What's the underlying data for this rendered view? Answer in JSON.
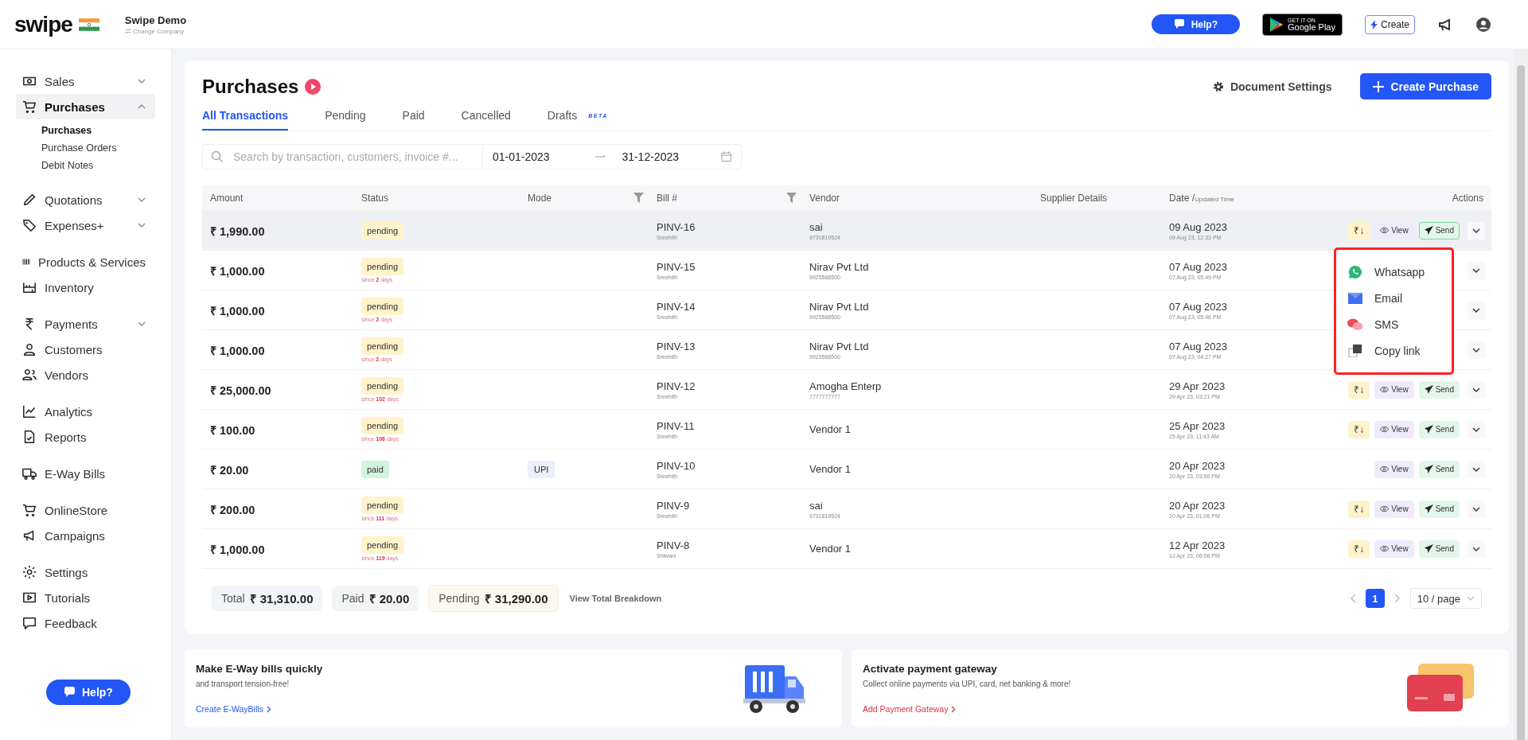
{
  "header": {
    "logo": "swipe",
    "company": "Swipe Demo",
    "change_company": "Change Company",
    "help": "Help?",
    "store_badge": {
      "small": "GET IT ON",
      "large": "Google Play"
    },
    "create": "Create"
  },
  "sidebar": {
    "sections": [
      [
        {
          "label": "Sales",
          "expanded": false,
          "selected": false
        },
        {
          "label": "Purchases",
          "expanded": true,
          "selected": true,
          "children": [
            {
              "label": "Purchases",
              "selected": true
            },
            {
              "label": "Purchase Orders",
              "selected": false
            },
            {
              "label": "Debit Notes",
              "selected": false
            }
          ]
        }
      ],
      [
        {
          "label": "Quotations",
          "expanded": false,
          "selected": false
        },
        {
          "label": "Expenses+",
          "expanded": false,
          "selected": false
        }
      ],
      [
        {
          "label": "Products & Services",
          "selected": false
        },
        {
          "label": "Inventory",
          "selected": false
        }
      ],
      [
        {
          "label": "Payments",
          "expanded": false,
          "selected": false
        },
        {
          "label": "Customers",
          "selected": false
        },
        {
          "label": "Vendors",
          "selected": false
        }
      ],
      [
        {
          "label": "Analytics",
          "selected": false
        },
        {
          "label": "Reports",
          "selected": false
        }
      ],
      [
        {
          "label": "E-Way Bills",
          "selected": false
        }
      ],
      [
        {
          "label": "OnlineStore",
          "selected": false
        },
        {
          "label": "Campaigns",
          "selected": false
        }
      ],
      [
        {
          "label": "Settings",
          "selected": false
        },
        {
          "label": "Tutorials",
          "selected": false
        },
        {
          "label": "Feedback",
          "selected": false
        }
      ]
    ],
    "help": "Help?"
  },
  "page": {
    "title": "Purchases",
    "document_settings": "Document Settings",
    "create_purchase": "Create Purchase",
    "tabs": [
      {
        "label": "All Transactions",
        "selected": true
      },
      {
        "label": "Pending",
        "selected": false
      },
      {
        "label": "Paid",
        "selected": false
      },
      {
        "label": "Cancelled",
        "selected": false
      },
      {
        "label": "Drafts",
        "badge": "BETA",
        "selected": false
      }
    ],
    "search": {
      "placeholder": "Search by transaction, customers, invoice #..."
    },
    "date_from": "01-01-2023",
    "date_to": "31-12-2023"
  },
  "table": {
    "columns": [
      {
        "label": "Amount"
      },
      {
        "label": "Status"
      },
      {
        "label": "Mode",
        "filter": true
      },
      {
        "label": "Bill #",
        "filter": true
      },
      {
        "label": "Vendor"
      },
      {
        "label": "Supplier Details"
      },
      {
        "label": "Date /",
        "sub": "Updated Time"
      },
      {
        "label": "Actions"
      }
    ],
    "rows": [
      {
        "amount": "₹ 1,990.00",
        "status": {
          "label": "pending",
          "kind": "pending"
        },
        "bill": "PINV-16",
        "bill_by": "Sreehith",
        "vendor": "sai",
        "vendor_phone": "9731819524",
        "date": "09 Aug 2023",
        "time": "09 Aug 23, 12:33 PM",
        "highlighted": true,
        "actions": [
          {
            "kind": "pay",
            "label": "₹↓",
            "active": false
          },
          {
            "kind": "view",
            "label": "View",
            "active": false
          },
          {
            "kind": "send",
            "label": "Send",
            "active": true
          }
        ]
      },
      {
        "amount": "₹ 1,000.00",
        "status": {
          "label": "pending",
          "kind": "pending"
        },
        "since": "since **2** days",
        "bill": "PINV-15",
        "bill_by": "Sreehith",
        "vendor": "Nirav Pvt Ltd",
        "vendor_phone": "9925568500",
        "date": "07 Aug 2023",
        "time": "07 Aug 23, 05:49 PM",
        "highlighted": false
      },
      {
        "amount": "₹ 1,000.00",
        "status": {
          "label": "pending",
          "kind": "pending"
        },
        "since": "since **2** days",
        "bill": "PINV-14",
        "bill_by": "Sreehith",
        "vendor": "Nirav Pvt Ltd",
        "vendor_phone": "9925568500",
        "date": "07 Aug 2023",
        "time": "07 Aug 23, 05:46 PM",
        "highlighted": false
      },
      {
        "amount": "₹ 1,000.00",
        "status": {
          "label": "pending",
          "kind": "pending"
        },
        "since": "since **2** days",
        "bill": "PINV-13",
        "bill_by": "Sreehith",
        "vendor": "Nirav Pvt Ltd",
        "vendor_phone": "9925568500",
        "date": "07 Aug 2023",
        "time": "07 Aug 23, 04:27 PM",
        "highlighted": false
      },
      {
        "amount": "₹ 25,000.00",
        "status": {
          "label": "pending",
          "kind": "pending"
        },
        "since": "since **102** days",
        "bill": "PINV-12",
        "bill_by": "Sreehith",
        "vendor": "Amogha Enterp",
        "vendor_phone": "7777777777",
        "date": "29 Apr 2023",
        "time": "29 Apr 23, 03:21 PM",
        "highlighted": false,
        "actions": [
          {
            "kind": "pay",
            "label": "₹↓",
            "active": false
          },
          {
            "kind": "view",
            "label": "View",
            "active": false
          },
          {
            "kind": "send",
            "label": "Send",
            "active": false
          }
        ]
      },
      {
        "amount": "₹ 100.00",
        "status": {
          "label": "pending",
          "kind": "pending"
        },
        "since": "since **106** days",
        "bill": "PINV-11",
        "bill_by": "Sreehith",
        "vendor": "Vendor 1",
        "date": "25 Apr 2023",
        "time": "25 Apr 23, 11:43 AM",
        "highlighted": false,
        "actions": [
          {
            "kind": "pay",
            "label": "₹↓",
            "active": false
          },
          {
            "kind": "view",
            "label": "View",
            "active": false
          },
          {
            "kind": "send",
            "label": "Send",
            "active": false
          }
        ]
      },
      {
        "amount": "₹ 20.00",
        "status": {
          "label": "paid",
          "kind": "paid"
        },
        "mode": "UPI",
        "bill": "PINV-10",
        "bill_by": "Sreehith",
        "vendor": "Vendor 1",
        "date": "20 Apr 2023",
        "time": "20 Apr 23, 03:50 PM",
        "highlighted": false,
        "actions": [
          {
            "kind": "view",
            "label": "View",
            "active": false
          },
          {
            "kind": "send",
            "label": "Send",
            "active": false
          }
        ]
      },
      {
        "amount": "₹ 200.00",
        "status": {
          "label": "pending",
          "kind": "pending"
        },
        "since": "since **111** days",
        "bill": "PINV-9",
        "bill_by": "Sreehith",
        "vendor": "sai",
        "vendor_phone": "9731819524",
        "date": "20 Apr 2023",
        "time": "20 Apr 23, 01:06 PM",
        "highlighted": false,
        "actions": [
          {
            "kind": "pay",
            "label": "₹↓",
            "active": false
          },
          {
            "kind": "view",
            "label": "View",
            "active": false
          },
          {
            "kind": "send",
            "label": "Send",
            "active": false
          }
        ]
      },
      {
        "amount": "₹ 1,000.00",
        "status": {
          "label": "pending",
          "kind": "pending"
        },
        "since": "since **119** days",
        "bill": "PINV-8",
        "bill_by": "Shiwani",
        "vendor": "Vendor 1",
        "date": "12 Apr 2023",
        "time": "12 Apr 23, 06:06 PM",
        "highlighted": false,
        "actions": [
          {
            "kind": "pay",
            "label": "₹↓",
            "active": false
          },
          {
            "kind": "view",
            "label": "View",
            "active": false
          },
          {
            "kind": "send",
            "label": "Send",
            "active": false
          }
        ]
      }
    ]
  },
  "send_menu": {
    "items": [
      {
        "label": "Whatsapp"
      },
      {
        "label": "Email"
      },
      {
        "label": "SMS"
      },
      {
        "label": "Copy link"
      }
    ]
  },
  "totals": [
    {
      "label": "Total",
      "value": "₹ 31,310.00",
      "kind": "total"
    },
    {
      "label": "Paid",
      "value": "₹ 20.00",
      "kind": "paid"
    },
    {
      "label": "Pending",
      "value": "₹ 31,290.00",
      "kind": "pending"
    }
  ],
  "breakdown_link": "View Total Breakdown",
  "pagination": {
    "pages": [
      {
        "label": "1",
        "selected": true
      }
    ],
    "page_size": "10 / page"
  },
  "promos": [
    {
      "kind": "truck",
      "title": "Make E-Way bills quickly",
      "text": "and transport tension-free!",
      "link": "Create E-WayBills"
    },
    {
      "kind": "card",
      "title": "Activate payment gateway",
      "text": "Collect online payments via UPI, card, net banking & more!",
      "link": "Add Payment Gateway"
    }
  ]
}
